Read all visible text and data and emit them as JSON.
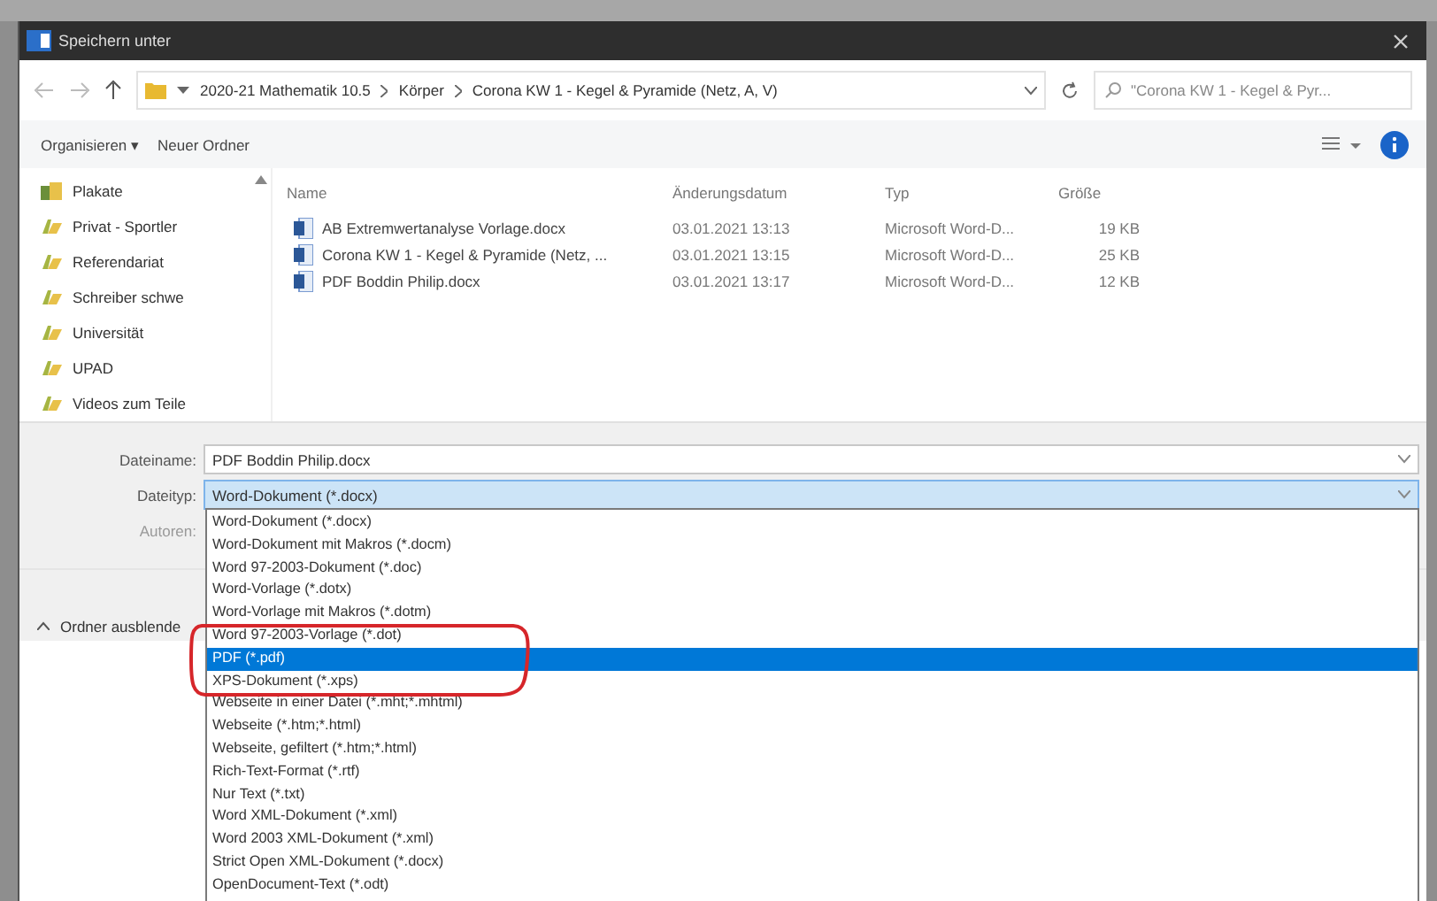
{
  "window": {
    "title": "Speichern unter"
  },
  "address_bar": {
    "path": [
      "2020-21 Mathematik 10.5",
      "Körper",
      "Corona KW 1 - Kegel & Pyramide (Netz, A, V)"
    ],
    "search": {
      "placeholder": "\"Corona KW 1 - Kegel & Pyr..."
    }
  },
  "toolbar": {
    "buttons": [
      "Organisieren ▾",
      "Neuer Ordner"
    ]
  },
  "sidebar": {
    "items": [
      {
        "label": "Plakate",
        "kind": "special"
      },
      {
        "label": "Privat - Sportler",
        "kind": "folder"
      },
      {
        "label": "Referendariat",
        "kind": "folder"
      },
      {
        "label": "Schreiber schwe",
        "kind": "folder"
      },
      {
        "label": "Universität",
        "kind": "folder"
      },
      {
        "label": "UPAD",
        "kind": "folder"
      },
      {
        "label": "Videos zum Teile",
        "kind": "folder"
      }
    ]
  },
  "table": {
    "columns": [
      "Name",
      "Änderungsdatum",
      "Typ",
      "Größe"
    ],
    "rows": [
      [
        "AB Extremwertanalyse Vorlage.docx",
        "03.01.2021 13:13",
        "Microsoft Word-D...",
        "19 KB"
      ],
      [
        "Corona KW 1 - Kegel & Pyramide (Netz, ...",
        "03.01.2021 13:15",
        "Microsoft Word-D...",
        "25 KB"
      ],
      [
        "PDF Boddin Philip.docx",
        "03.01.2021 13:17",
        "Microsoft Word-D...",
        "12 KB"
      ]
    ]
  },
  "form": {
    "fields": [
      {
        "label": "Dateiname:",
        "value": "PDF Boddin Philip.docx"
      },
      {
        "label": "Dateityp:",
        "value": "Word-Dokument (*.docx)"
      }
    ],
    "authors_label": "Autoren:"
  },
  "hide_folders": "Ordner ausblende",
  "file_type_list": [
    {
      "label": "Word-Dokument (*.docx)",
      "selected": false
    },
    {
      "label": "Word-Dokument mit Makros (*.docm)",
      "selected": false
    },
    {
      "label": "Word 97-2003-Dokument (*.doc)",
      "selected": false
    },
    {
      "label": "Word-Vorlage (*.dotx)",
      "selected": false
    },
    {
      "label": "Word-Vorlage mit Makros (*.dotm)",
      "selected": false
    },
    {
      "label": "Word 97-2003-Vorlage (*.dot)",
      "selected": false
    },
    {
      "label": "PDF (*.pdf)",
      "selected": true
    },
    {
      "label": "XPS-Dokument (*.xps)",
      "selected": false
    },
    {
      "label": "Webseite in einer Datei (*.mht;*.mhtml)",
      "selected": false
    },
    {
      "label": "Webseite (*.htm;*.html)",
      "selected": false
    },
    {
      "label": "Webseite, gefiltert (*.htm;*.html)",
      "selected": false
    },
    {
      "label": "Rich-Text-Format (*.rtf)",
      "selected": false
    },
    {
      "label": "Nur Text (*.txt)",
      "selected": false
    },
    {
      "label": "Word XML-Dokument (*.xml)",
      "selected": false
    },
    {
      "label": "Word 2003 XML-Dokument (*.xml)",
      "selected": false
    },
    {
      "label": "Strict Open XML-Dokument (*.docx)",
      "selected": false
    },
    {
      "label": "OpenDocument-Text (*.odt)",
      "selected": false
    }
  ]
}
